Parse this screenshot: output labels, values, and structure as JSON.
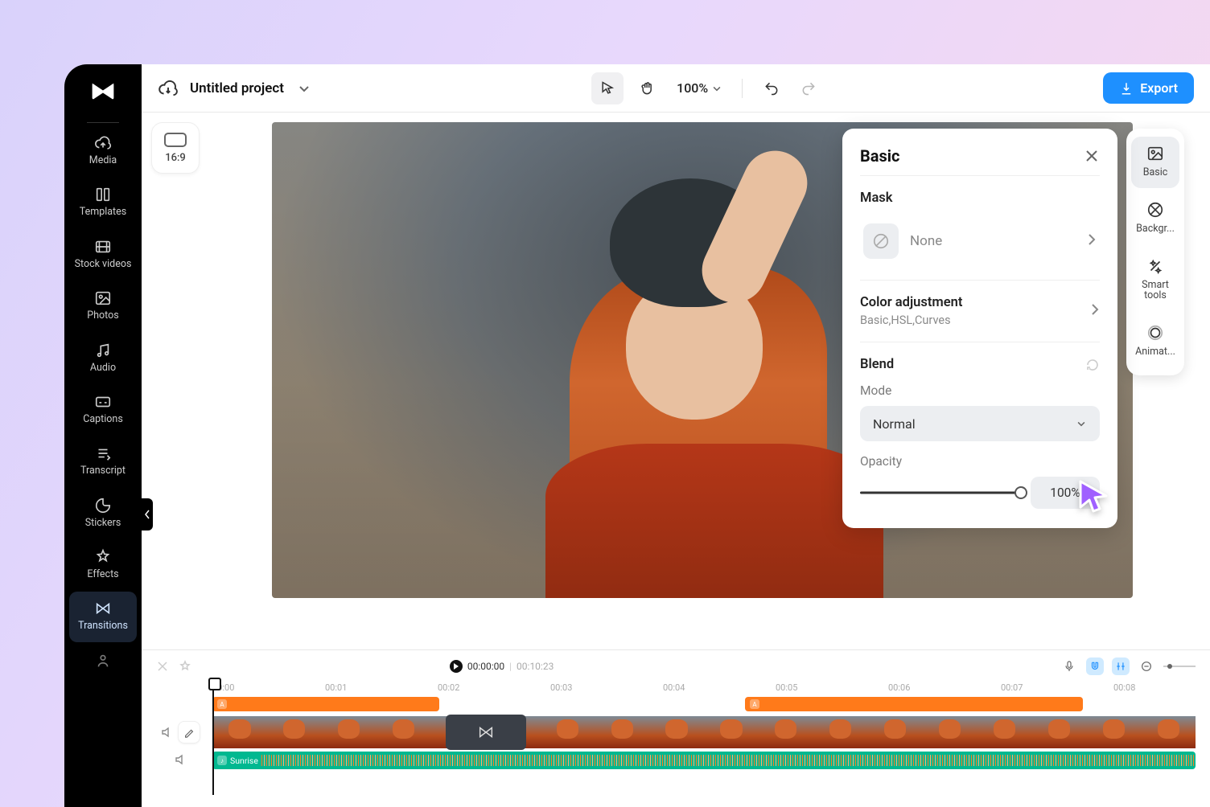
{
  "sidebar": {
    "items": [
      {
        "label": "Media",
        "icon": "cloud-upload"
      },
      {
        "label": "Templates",
        "icon": "templates"
      },
      {
        "label": "Stock videos",
        "icon": "film"
      },
      {
        "label": "Photos",
        "icon": "photo"
      },
      {
        "label": "Audio",
        "icon": "music"
      },
      {
        "label": "Captions",
        "icon": "captions"
      },
      {
        "label": "Transcript",
        "icon": "transcript"
      },
      {
        "label": "Stickers",
        "icon": "sticker"
      },
      {
        "label": "Effects",
        "icon": "effects"
      },
      {
        "label": "Transitions",
        "icon": "transitions"
      }
    ]
  },
  "topbar": {
    "project_title": "Untitled project",
    "zoom": "100%",
    "export_label": "Export"
  },
  "preview": {
    "aspect_label": "16:9"
  },
  "rail": {
    "items": [
      {
        "label": "Basic",
        "active": true
      },
      {
        "label": "Backgr...",
        "active": false
      },
      {
        "label": "Smart tools",
        "active": false
      },
      {
        "label": "Animat...",
        "active": false
      }
    ]
  },
  "panel": {
    "title": "Basic",
    "mask_label": "Mask",
    "mask_value": "None",
    "color_title": "Color adjustment",
    "color_sub": "Basic,HSL,Curves",
    "blend_label": "Blend",
    "mode_label": "Mode",
    "mode_value": "Normal",
    "opacity_label": "Opacity",
    "opacity_value": "100%"
  },
  "timeline": {
    "current_time": "00:00:00",
    "duration": "00:10:23",
    "ruler": [
      "00:00",
      "00:01",
      "00:02",
      "00:03",
      "00:04",
      "00:05",
      "00:06",
      "00:07",
      "00:08"
    ],
    "audio_name": "Sunrise"
  }
}
